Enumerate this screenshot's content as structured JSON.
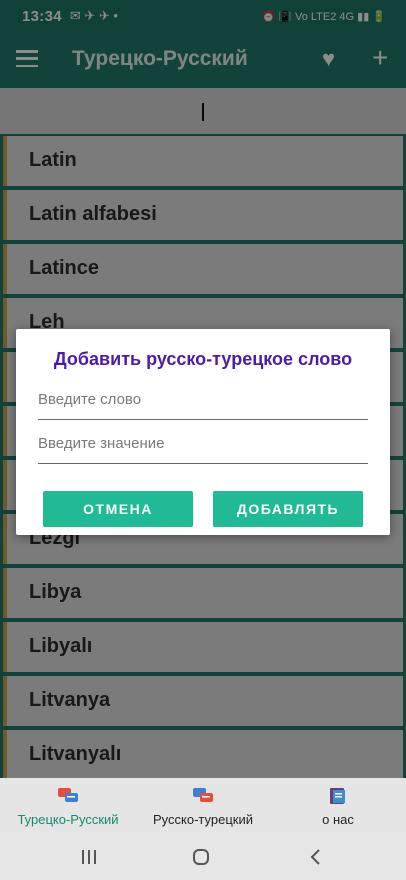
{
  "status": {
    "time": "13:34",
    "left_icons": "✉ ✈ ✈ •",
    "right_icons": "⏰ 📳 Vo LTE2 4G ▮▮ 🔋"
  },
  "appbar": {
    "title": "Турецко-Русский"
  },
  "list": {
    "items": [
      "Latin",
      "Latin alfabesi",
      "Latince",
      "Leh",
      "",
      "",
      "",
      "Lezgi",
      "Libya",
      "Libyalı",
      "Litvanya",
      "Litvanyalı"
    ]
  },
  "dialog": {
    "title": "Добавить русско-турецкое слово",
    "word_placeholder": "Введите слово",
    "meaning_placeholder": "Введите значение",
    "cancel": "ОТМЕНА",
    "add": "ДОБАВЛЯТЬ"
  },
  "bottomnav": {
    "items": [
      {
        "label": "Турецко-Русский",
        "icon": "chat-bubbles-icon",
        "active": true
      },
      {
        "label": "Русско-турецкий",
        "icon": "chat-bubbles-icon",
        "active": false
      },
      {
        "label": "о нас",
        "icon": "book-icon",
        "active": false
      }
    ]
  },
  "colors": {
    "primary": "#1f7a6b",
    "accent": "#20ba94",
    "active_tab": "#138a6a",
    "dialog_title": "#4d1ba8"
  }
}
